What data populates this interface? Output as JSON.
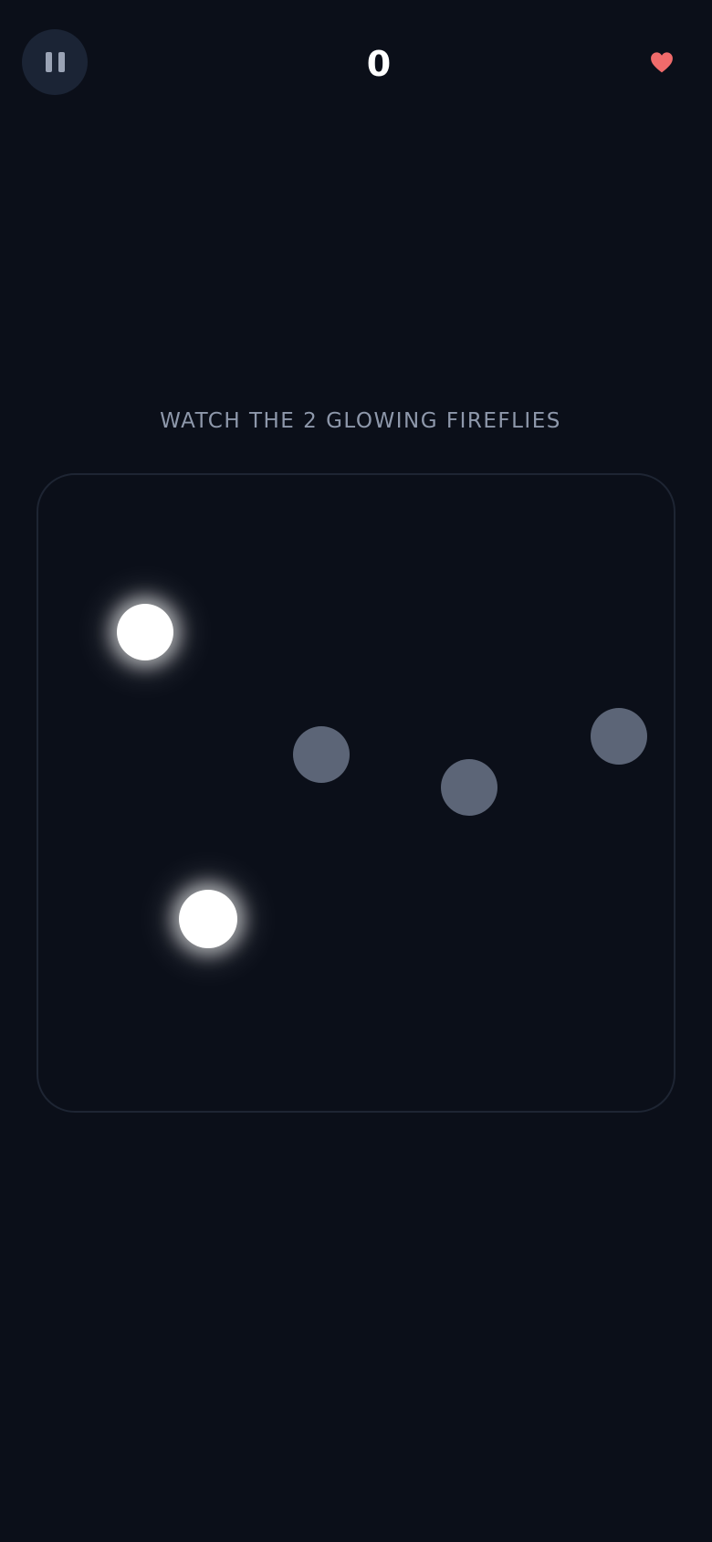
{
  "hud": {
    "score": "0",
    "lives": 1,
    "heart_color": "#f06b6b",
    "pause_icon": "pause-icon"
  },
  "instruction": "WATCH THE 2 GLOWING FIREFLIES",
  "board": {
    "fireflies": [
      {
        "id": "firefly-1",
        "state": "glowing"
      },
      {
        "id": "firefly-2",
        "state": "dim"
      },
      {
        "id": "firefly-3",
        "state": "dim"
      },
      {
        "id": "firefly-4",
        "state": "dim"
      },
      {
        "id": "firefly-5",
        "state": "glowing"
      }
    ]
  },
  "colors": {
    "background": "#0b0f19",
    "glow": "#ffffff",
    "dim": "#5c6577"
  }
}
